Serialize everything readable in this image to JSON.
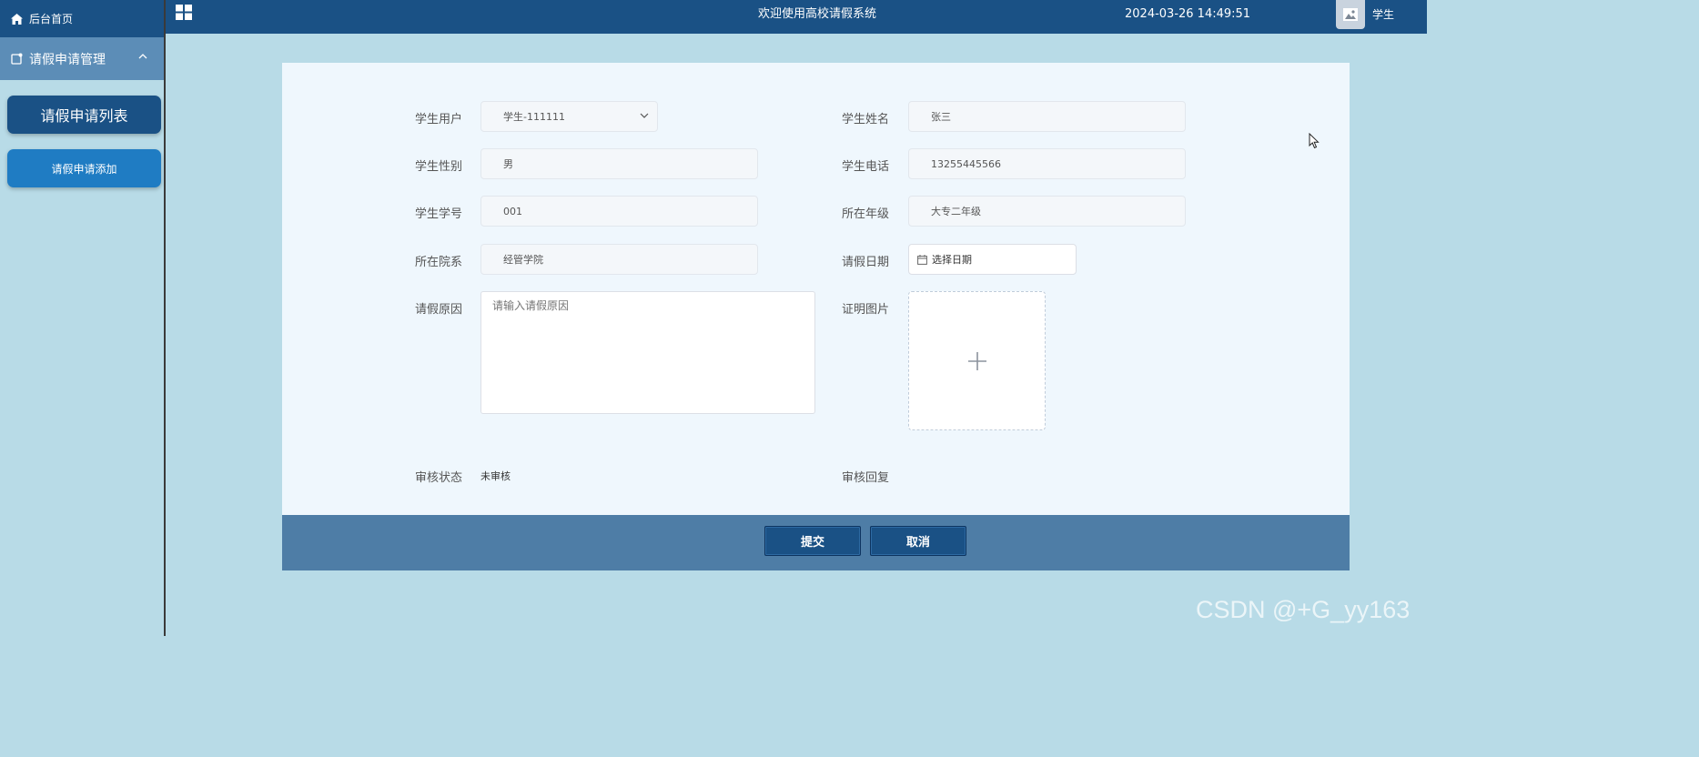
{
  "sidebar": {
    "home_label": "后台首页",
    "group_label": "请假申请管理",
    "items": [
      {
        "label": "请假申请列表"
      },
      {
        "label": "请假申请添加"
      }
    ]
  },
  "topbar": {
    "title": "欢迎使用高校请假系统",
    "datetime": "2024-03-26 14:49:51",
    "user_role": "学生"
  },
  "form": {
    "student_user": {
      "label": "学生用户",
      "value": "学生-111111"
    },
    "student_name": {
      "label": "学生姓名",
      "value": "张三"
    },
    "student_gender": {
      "label": "学生性别",
      "value": "男"
    },
    "student_phone": {
      "label": "学生电话",
      "value": "13255445566"
    },
    "student_id": {
      "label": "学生学号",
      "value": "001"
    },
    "grade": {
      "label": "所在年级",
      "value": "大专二年级"
    },
    "department": {
      "label": "所在院系",
      "value": "经管学院"
    },
    "leave_date": {
      "label": "请假日期",
      "placeholder": "选择日期"
    },
    "leave_reason": {
      "label": "请假原因",
      "placeholder": "请输入请假原因"
    },
    "proof_image": {
      "label": "证明图片"
    },
    "review_status": {
      "label": "审核状态",
      "value": "未审核"
    },
    "review_reply": {
      "label": "审核回复"
    }
  },
  "buttons": {
    "submit": "提交",
    "cancel": "取消"
  },
  "watermark": "CSDN @+G_yy163",
  "colors": {
    "primary": "#1a5185",
    "accent": "#1f7cc3",
    "page_bg": "#b8dbe7",
    "card_bg": "#eff7fd",
    "footer_bg": "#4e7da6"
  }
}
